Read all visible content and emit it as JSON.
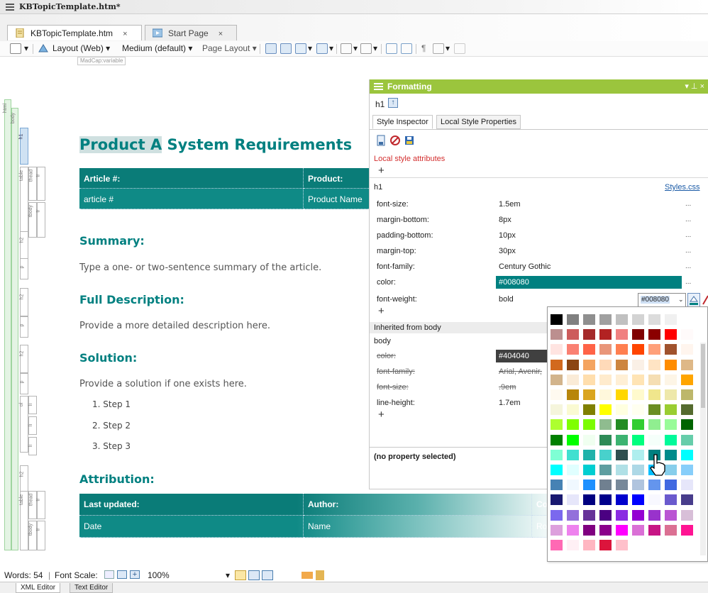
{
  "window": {
    "title": "KBTopicTemplate.htm*"
  },
  "tabs": [
    {
      "label": "KBTopicTemplate.htm",
      "close": "×"
    },
    {
      "label": "Start Page",
      "close": "×"
    }
  ],
  "toolbar": {
    "layout": "Layout (Web)",
    "medium": "Medium (default)",
    "page_layout": "Page Layout"
  },
  "madcap_tag": "MadCap:variable",
  "structure": {
    "labels": [
      "html",
      "body",
      "h1",
      "table",
      "thead",
      "tr",
      "tbody",
      "tr",
      "h2",
      "p",
      "h2",
      "p",
      "h2",
      "p",
      "ol",
      "li",
      "li",
      "li",
      "h2",
      "table",
      "thead",
      "tr",
      "tbody",
      "tr"
    ]
  },
  "document": {
    "h1_highlight": "Product A",
    "h1_rest": " System Requirements",
    "table1": {
      "header": [
        "Article #:",
        "Product:"
      ],
      "row": [
        "article #",
        "Product Name"
      ]
    },
    "summary_heading": "Summary:",
    "summary_text": "Type a one- or two-sentence summary of the article.",
    "full_heading": "Full Description:",
    "full_text": "Provide a more detailed description here.",
    "solution_heading": "Solution:",
    "solution_text": "Provide a solution if one exists here.",
    "steps": [
      "1.  Step 1",
      "2.  Step 2",
      "3.  Step 3"
    ],
    "attribution_heading": "Attribution:",
    "table2": {
      "header": [
        "Last updated:",
        "Author:",
        "Co"
      ],
      "row": [
        "Date",
        "Name",
        "Ro"
      ]
    }
  },
  "formatting": {
    "title": "Formatting",
    "controls": "▾ ⊥ ×",
    "element": "h1",
    "tabs": [
      "Style Inspector",
      "Local Style Properties"
    ],
    "local_label": "Local style attributes",
    "plus": "+",
    "h1_label": "h1",
    "stylesheet_link": "Styles.css",
    "props": [
      {
        "name": "font-size:",
        "value": "1.5em"
      },
      {
        "name": "margin-bottom:",
        "value": "8px"
      },
      {
        "name": "padding-bottom:",
        "value": "10px"
      },
      {
        "name": "margin-top:",
        "value": "30px"
      },
      {
        "name": "font-family:",
        "value": "Century Gothic"
      },
      {
        "name": "color:",
        "value": "#008080"
      },
      {
        "name": "font-weight:",
        "value": "bold"
      }
    ],
    "dots": "...",
    "inherited_label": "Inherited from body",
    "body_label": "body",
    "body_props": [
      {
        "name": "color:",
        "value": "#404040"
      },
      {
        "name": "font-family:",
        "value": "Arial, Avenir,"
      },
      {
        "name": "font-size:",
        "value": ".9em"
      },
      {
        "name": "line-height:",
        "value": "1.7em"
      }
    ],
    "status": "(no property selected)",
    "color_field": "#008080"
  },
  "picker": {
    "swatches": [
      [
        "#000000",
        "#808080",
        "#8f8f8f",
        "#a0a0a0",
        "#c0c0c0",
        "#d3d3d3",
        "#dcdcdc",
        "#f0f0f0",
        null
      ],
      [
        "#bc8f8f",
        "#cd5c5c",
        "#a52a2a",
        "#b22222",
        "#f08080",
        "#800000",
        "#8b0000",
        "#ff0000",
        "#fffafa"
      ],
      [
        "#ffe4e1",
        "#fa8072",
        "#ff6347",
        "#e9967a",
        "#ff7f50",
        "#ff4500",
        "#ffa07a",
        "#a0522d",
        "#fff5ee"
      ],
      [
        "#d2691e",
        "#8b4513",
        "#f4a460",
        "#ffdab9",
        "#cd853f",
        "#faf0e6",
        "#ffe4c4",
        "#ff8c00",
        "#deb887"
      ],
      [
        "#d2b48c",
        "#faebd7",
        "#ffdead",
        "#ffebcd",
        "#ffefd5",
        "#ffe4b5",
        "#f5deb3",
        "#fdf5e6",
        "#ffa500"
      ],
      [
        "#fffaf0",
        "#b8860b",
        "#daa520",
        "#fff8dc",
        "#ffd700",
        "#fffacd",
        "#f0e68c",
        "#eee8aa",
        "#bdb76b"
      ],
      [
        "#f5f5dc",
        "#fafad2",
        "#808000",
        "#ffff00",
        "#ffffe0",
        "#fffff0",
        "#6b8e23",
        "#9acd32",
        "#556b2f"
      ],
      [
        "#adff2f",
        "#7fff00",
        "#7cfc00",
        "#8fbc8f",
        "#228b22",
        "#32cd32",
        "#90ee90",
        "#98fb98",
        "#006400"
      ],
      [
        "#008000",
        "#00ff00",
        "#f0fff0",
        "#2e8b57",
        "#3cb371",
        "#00ff7f",
        "#f5fffa",
        "#00fa9a",
        "#66cdaa"
      ],
      [
        "#7fffd4",
        "#40e0d0",
        "#20b2aa",
        "#48d1cc",
        "#2f4f4f",
        "#afeeee",
        "#008080",
        "#008b8b",
        "#00ffff"
      ],
      [
        "#00ffff",
        "#e0ffff",
        "#00ced1",
        "#5f9ea0",
        "#b0e0e6",
        "#add8e6",
        "#00bfff",
        "#87ceeb",
        "#87cefa"
      ],
      [
        "#4682b4",
        "#f0f8ff",
        "#1e90ff",
        "#708090",
        "#778899",
        "#b0c4de",
        "#6495ed",
        "#4169e1",
        "#e6e6fa"
      ],
      [
        "#191970",
        "#e6e6fa",
        "#000080",
        "#00008b",
        "#0000cd",
        "#0000ff",
        "#f8f8ff",
        "#6a5acd",
        "#483d8b"
      ],
      [
        "#7b68ee",
        "#9370db",
        "#663399",
        "#4b0082",
        "#8a2be2",
        "#9400d3",
        "#9932cc",
        "#ba55d3",
        "#d8bfd8"
      ],
      [
        "#dda0dd",
        "#ee82ee",
        "#800080",
        "#8b008b",
        "#ff00ff",
        "#da70d6",
        "#c71585",
        "#db7093",
        "#ff1493"
      ],
      [
        "#ff69b4",
        "#fff0f5",
        "#ffb6c1",
        "#dc143c",
        "#ffc0cb",
        null,
        null,
        null,
        null
      ]
    ]
  },
  "statusbar": {
    "words": "Words: 54",
    "font_scale": "Font Scale:",
    "zoom": "100%"
  },
  "bottom_tabs": [
    "XML Editor",
    "Text Editor"
  ]
}
